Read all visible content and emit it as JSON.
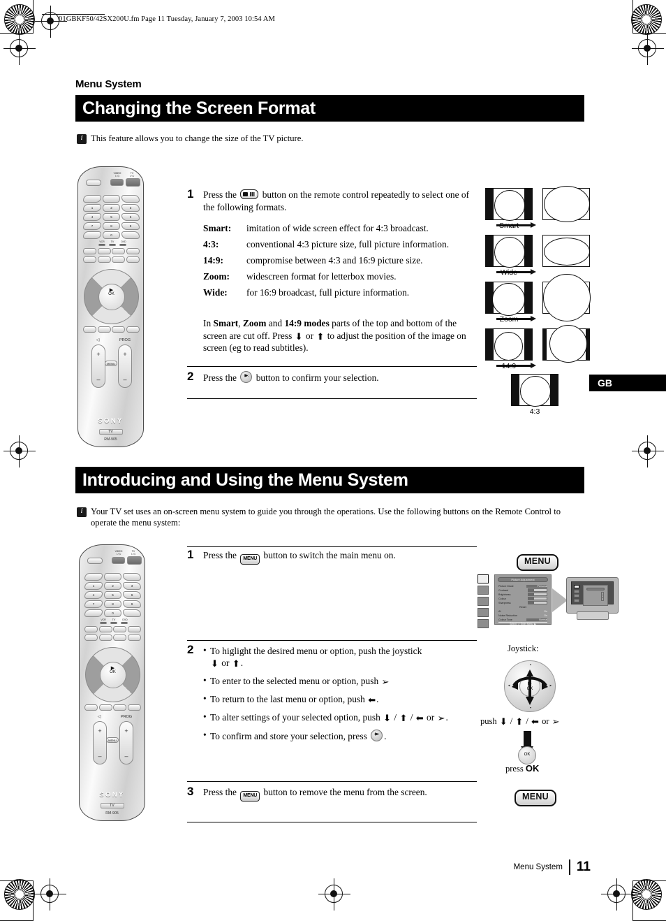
{
  "print_header": {
    "filename_line": "01GBKF50/42SX200U.fm  Page 11  Tuesday, January 7, 2003  10:54 AM"
  },
  "section1": {
    "kicker": "Menu System",
    "banner_title": "Changing the Screen Format",
    "intro": "This feature allows you to change the size of the TV picture.",
    "steps": [
      {
        "num": "1",
        "text_before_icon": "Press the",
        "icon": "widescreen-button-icon",
        "text_after_icon": "button on the remote control repeatedly to select one of the following formats.",
        "formats": [
          {
            "term": "Smart:",
            "desc": "imitation of wide screen effect for 4:3 broadcast."
          },
          {
            "term": "4:3:",
            "desc": "conventional 4:3 picture size, full picture information."
          },
          {
            "term": "14:9:",
            "desc": "compromise between 4:3 and 16:9 picture size."
          },
          {
            "term": "Zoom:",
            "desc": "widescreen format for letterbox movies."
          },
          {
            "term": "Wide:",
            "desc": "for 16:9 broadcast, full picture information."
          }
        ],
        "note_part1": "In ",
        "note_bold1": "Smart",
        "note_part2": ", ",
        "note_bold2": "Zoom",
        "note_part3": " and ",
        "note_bold3": "14:9 modes",
        "note_part4": " parts of the top and bottom of the screen are cut off. Press",
        "note_part5": "or",
        "note_part6": "to adjust the position of the image on screen (eg to read subtitles)."
      },
      {
        "num": "2",
        "text_before_icon": "Press the",
        "icon": "ok-button-icon",
        "text_after_icon": "button to confirm your selection."
      }
    ],
    "format_diagrams": [
      {
        "label": "Smart",
        "left_ratio": "4:3",
        "right_ratio": "16:9"
      },
      {
        "label": "Wide",
        "left_ratio": "4:3",
        "right_ratio": "16:9"
      },
      {
        "label": "Zoom",
        "left_ratio": "4:3",
        "right_ratio": "16:9"
      },
      {
        "label": "14:9",
        "left_ratio": "4:3",
        "right_ratio": "14:9"
      },
      {
        "label": "4:3",
        "left_ratio": "4:3",
        "right_ratio": ""
      }
    ]
  },
  "section2": {
    "banner_title": "Introducing and Using the Menu System",
    "intro": "Your TV set uses an on-screen menu system to guide you through the operations. Use the following buttons on the Remote Control to operate the menu system:",
    "steps": [
      {
        "num": "1",
        "text_before_icon": "Press the",
        "icon": "menu-button-icon",
        "icon_label": "MENU",
        "text_after_icon": "button to switch the main menu on."
      },
      {
        "num": "2",
        "bullets": [
          {
            "text_a": "To higlight the desired menu or option, push the joystick",
            "arrows": [
              "down",
              "up"
            ],
            "text_b": "or",
            "text_c": "."
          },
          {
            "text_a": "To enter to the selected menu or option, push",
            "arrows": [
              "right"
            ],
            "text_b": "",
            "text_c": ""
          },
          {
            "text_a": "To return to the last menu or option, push",
            "arrows": [
              "left"
            ],
            "text_b": "",
            "text_c": "."
          },
          {
            "text_a": "To alter settings of your selected option, push",
            "arrows": [
              "down",
              "up",
              "left",
              "right"
            ],
            "text_b": "or",
            "text_c": "."
          },
          {
            "text_a": "To confirm and store your selection, press",
            "arrows": [],
            "icon": "ok-button-icon",
            "text_c": "."
          }
        ]
      },
      {
        "num": "3",
        "text_before_icon": "Press the",
        "icon": "menu-button-icon",
        "icon_label": "MENU",
        "text_after_icon": "button to remove the menu from the screen."
      }
    ],
    "osd": {
      "menu_badge": "MENU",
      "title": "Picture Adjustment",
      "rows": [
        {
          "name": "Picture Mode",
          "value": "Personal",
          "type": "value"
        },
        {
          "name": "Contrast",
          "value": "",
          "type": "bar"
        },
        {
          "name": "Brightness",
          "value": "",
          "type": "bar"
        },
        {
          "name": "Colour",
          "value": "",
          "type": "bar"
        },
        {
          "name": "Sharpness",
          "value": "",
          "type": "bar"
        },
        {
          "name": "Reset",
          "value": "",
          "type": "plain"
        },
        {
          "name": "AI",
          "value": "On",
          "type": "value"
        },
        {
          "name": "Noise Reduction",
          "value": "On",
          "type": "value"
        },
        {
          "name": "Colour Tone",
          "value": "Normal",
          "type": "value"
        }
      ],
      "footer": "Select: ↓↑  Enter Menu: ▶"
    },
    "joystick": {
      "caption": "Joystick:",
      "ok_label": "OK",
      "push_label": "push",
      "push_arrows": [
        "down",
        "up",
        "left",
        "right"
      ],
      "push_or": "or",
      "press_prefix": "press ",
      "press_label": "OK",
      "menu_badge": "MENU"
    }
  },
  "remote": {
    "brand": "SONY",
    "device_tag": "TV",
    "model": "RM-905",
    "top_labels": {
      "video": "VIDEO",
      "video_power": "I / ⏻",
      "tv": "TV",
      "tv_power": "I / ⏻"
    },
    "keypad": [
      [
        "",
        "",
        ""
      ],
      [
        "1",
        "2",
        "3"
      ],
      [
        "4",
        "5",
        "6"
      ],
      [
        "7",
        "8",
        "9"
      ],
      [
        "",
        "0",
        ""
      ]
    ],
    "source_labels": [
      "VCR",
      "TV",
      "DVD"
    ],
    "volume_label": "◁",
    "prog_label": "PROG",
    "plus": "+",
    "minus": "–",
    "menu_key": "MENU",
    "ok_label": "OK"
  },
  "gb_tab": "GB",
  "footer": {
    "section": "Menu System",
    "page": "11"
  },
  "colors": {
    "banner_bg": "#000000",
    "banner_text": "#ffffff",
    "page_bg": "#ffffff",
    "tv_mask": "#111111"
  }
}
